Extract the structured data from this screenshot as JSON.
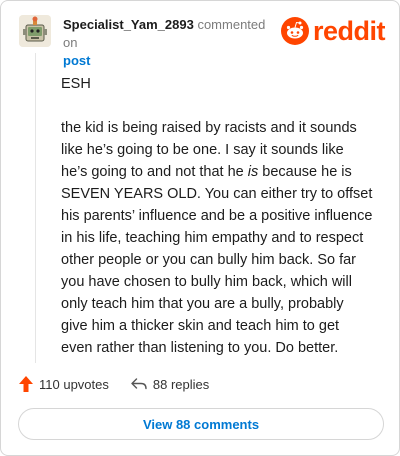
{
  "comment": {
    "username": "Specialist_Yam_2893",
    "commented_on_text": "commented on",
    "post_link_text": "post",
    "brand": "reddit",
    "body": {
      "paragraph_1": "ESH",
      "p2_before_italic": "the kid is being raised by racists and it sounds like he’s going to be one. I say it sounds like he’s going to and not that he ",
      "p2_italic": "is",
      "p2_after_italic": " because he is SEVEN YEARS OLD. You can either try to offset his parents’ influence and be a positive influence in his life, teaching him empathy and to respect other people or you can bully him back. So far you have chosen to bully him back, which will only teach him that you are a bully, probably give him a thicker skin and teach him to get even rather than listening to you. Do better."
    },
    "upvotes_label": "110 upvotes",
    "replies_label": "88 replies",
    "view_comments_label": "View 88 comments"
  },
  "icons": {
    "avatar": "snoo-avatar",
    "upvote": "upvote-arrow-icon",
    "reply": "reply-arrow-icon",
    "logo": "reddit-snoo-icon"
  },
  "colors": {
    "brand": "#ff4500",
    "link": "#0079d3",
    "text": "#1c1c1c",
    "muted": "#7c7c7c",
    "upvote": "#ff4500"
  }
}
